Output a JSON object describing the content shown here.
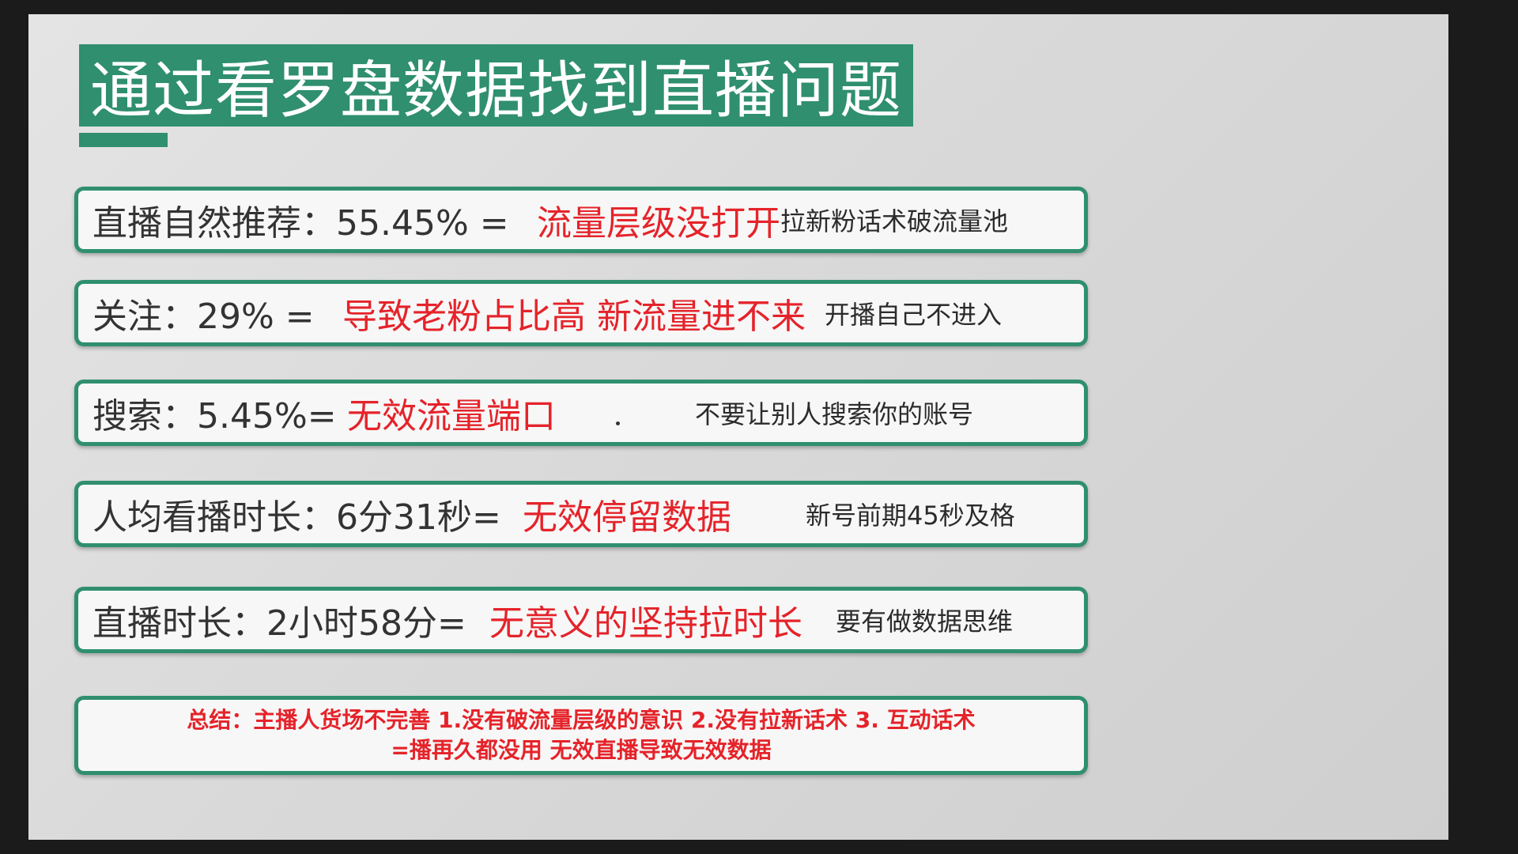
{
  "slide": {
    "title": "通过看罗盘数据找到直播问题",
    "rows": [
      {
        "label": "直播自然推荐：55.45% =",
        "problem": "流量层级没打开",
        "note": "拉新粉话术破流量池"
      },
      {
        "label": "关注：29%  =",
        "problem": "导致老粉占比高 新流量进不来",
        "note": "开播自己不进入"
      },
      {
        "label": "搜索：5.45%=",
        "problem": "无效流量端口",
        "note": "不要让别人搜索你的账号"
      },
      {
        "label": "人均看播时长：6分31秒=",
        "problem": "无效停留数据",
        "note": "新号前期45秒及格"
      },
      {
        "label": "直播时长：2小时58分=",
        "problem": "无意义的坚持拉时长",
        "note": "要有做数据思维"
      }
    ],
    "summary": {
      "line1": "总结：主播人货场不完善 1.没有破流量层级的意识 2.没有拉新话术 3. 互动话术",
      "line2": "=播再久都没用 无效直播导致无效数据"
    }
  },
  "colors": {
    "accent_green": "#2f8f6e",
    "problem_red": "#e5232a",
    "row_background": "#f7f7f7"
  }
}
